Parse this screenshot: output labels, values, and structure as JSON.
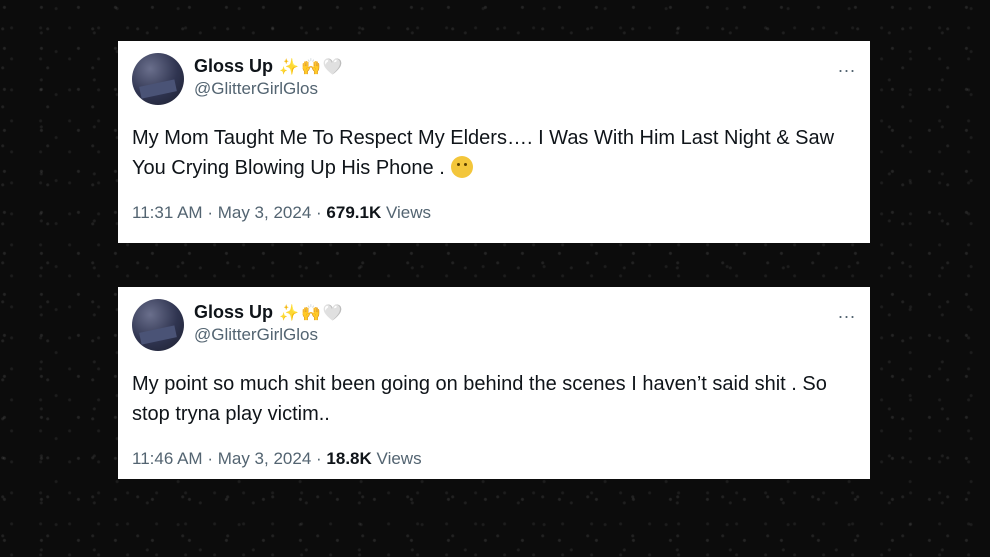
{
  "tweets": [
    {
      "display_name": "Gloss Up",
      "name_emojis": [
        "✨",
        "🙌",
        "🤍"
      ],
      "handle": "@GlitterGirlGlos",
      "more_label": "...",
      "text": "My Mom Taught Me To Respect My Elders…. I Was With Him Last Night & Saw You Crying Blowing Up His Phone .",
      "text_emoji": "pensive-face",
      "time": "11:31 AM",
      "date": "May 3, 2024",
      "views_count": "679.1K",
      "views_label": "Views"
    },
    {
      "display_name": "Gloss Up",
      "name_emojis": [
        "✨",
        "🙌",
        "🤍"
      ],
      "handle": "@GlitterGirlGlos",
      "more_label": "...",
      "text": "My point so much shit been going on behind the scenes I haven’t said shit . So stop tryna play victim..",
      "time": "11:46 AM",
      "date": "May 3, 2024",
      "views_count": "18.8K",
      "views_label": "Views"
    }
  ],
  "separator": "·"
}
